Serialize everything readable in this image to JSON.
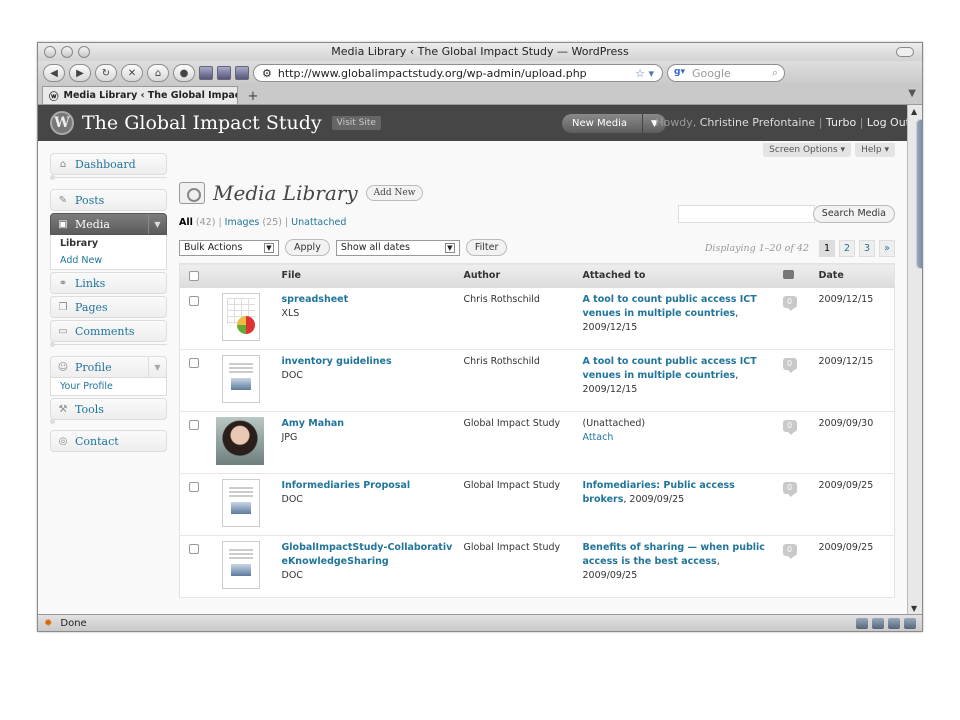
{
  "window": {
    "title": "Media Library ‹ The Global Impact Study — WordPress",
    "url": "http://www.globalimpactstudy.org/wp-admin/upload.php",
    "search_placeholder": "Google",
    "tab_title": "Media Library ‹ The Global Impact ...",
    "status": "Done"
  },
  "header": {
    "site_title": "The Global Impact Study",
    "visit_site": "Visit Site",
    "new_media": "New Media",
    "howdy": "Howdy,",
    "user": "Christine Prefontaine",
    "sep1": "|",
    "turbo": "Turbo",
    "sep2": "|",
    "logout": "Log Out"
  },
  "sidebar": {
    "dashboard": "Dashboard",
    "posts": "Posts",
    "media": "Media",
    "library": "Library",
    "add_new": "Add New",
    "links": "Links",
    "pages": "Pages",
    "comments": "Comments",
    "profile": "Profile",
    "your_profile": "Your Profile",
    "tools": "Tools",
    "contact": "Contact"
  },
  "main": {
    "screen_options": "Screen Options",
    "help": "Help",
    "title": "Media Library",
    "add_new": "Add New",
    "filter_all": "All",
    "filter_all_count": "(42)",
    "filter_images": "Images",
    "filter_images_count": "(25)",
    "filter_unattached": "Unattached",
    "search_button": "Search Media",
    "bulk_actions": "Bulk Actions",
    "apply": "Apply",
    "dates": "Show all dates",
    "filter": "Filter",
    "displaying": "Displaying 1–20 of 42",
    "pages": [
      "1",
      "2",
      "3",
      "»"
    ]
  },
  "table": {
    "columns": {
      "file": "File",
      "author": "Author",
      "attached": "Attached to",
      "date": "Date"
    },
    "rows": [
      {
        "thumb": "xls",
        "file": "spreadsheet",
        "type": "XLS",
        "author": "Chris Rothschild",
        "attached_link": "A tool to count public access ICT venues in multiple countries",
        "attached_tail": ", 2009/12/15",
        "comments": "0",
        "date": "2009/12/15"
      },
      {
        "thumb": "doc",
        "file": "inventory guidelines",
        "type": "DOC",
        "author": "Chris Rothschild",
        "attached_link": "A tool to count public access ICT venues in multiple countries",
        "attached_tail": ", 2009/12/15",
        "comments": "0",
        "date": "2009/12/15"
      },
      {
        "thumb": "photo",
        "file": "Amy Mahan",
        "type": "JPG",
        "author": "Global Impact Study",
        "attached_link": "",
        "attached_tail": "(Unattached)",
        "attach_action": "Attach",
        "comments": "0",
        "date": "2009/09/30"
      },
      {
        "thumb": "doc",
        "file": "Informediaries Proposal",
        "type": "DOC",
        "author": "Global Impact Study",
        "attached_link": "Infomediaries: Public access brokers",
        "attached_tail": ", 2009/09/25",
        "comments": "0",
        "date": "2009/09/25"
      },
      {
        "thumb": "doc",
        "file": "GlobalImpactStudy-CollaborativeKnowledgeSharing",
        "type": "DOC",
        "author": "Global Impact Study",
        "attached_link": "Benefits of sharing — when public access is the best access",
        "attached_tail": ", 2009/09/25",
        "comments": "0",
        "date": "2009/09/25"
      }
    ]
  }
}
